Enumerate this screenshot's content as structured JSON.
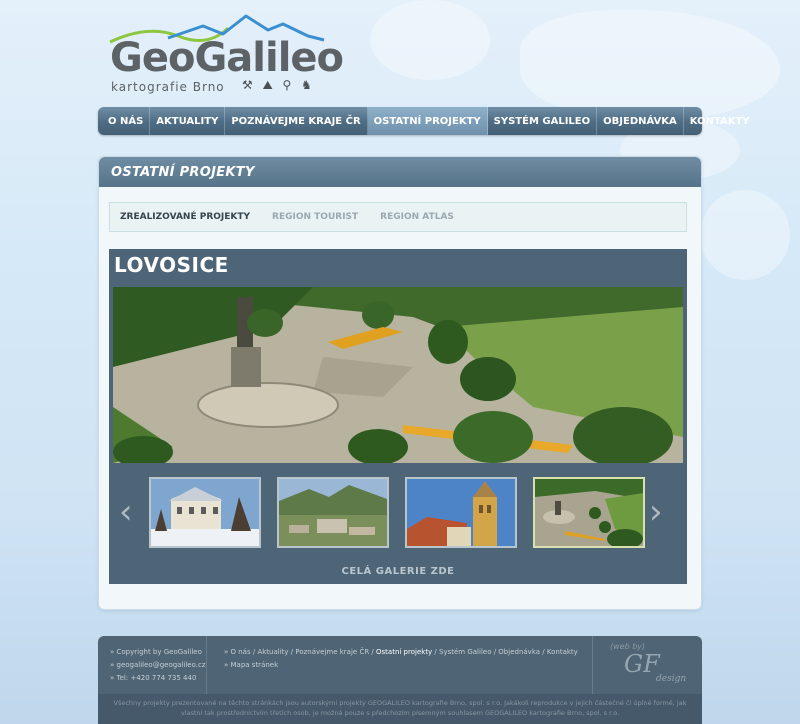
{
  "logo": {
    "title": "GeoGalileo",
    "subtitle": "kartografie Brno",
    "icons": "⚒ ⛰ ⚲ ♞",
    "colors": {
      "green": "#8dc63f",
      "blue": "#3a8fd1",
      "gray": "#5d6266"
    }
  },
  "nav": {
    "items": [
      {
        "label": "O nás"
      },
      {
        "label": "Aktuality"
      },
      {
        "label": "Poznávejme kraje ČR"
      },
      {
        "label": "Ostatní projekty"
      },
      {
        "label": "Systém Galileo"
      },
      {
        "label": "Objednávka"
      },
      {
        "label": "Kontakty"
      }
    ],
    "active_index": 3
  },
  "panel": {
    "title": "Ostatní projekty",
    "subnav": [
      {
        "label": "Zrealizované projekty"
      },
      {
        "label": "Region Tourist"
      },
      {
        "label": "Region Atlas"
      }
    ],
    "gallery": {
      "title": "LOVOSICE",
      "prev_icon": "chevron-left-icon",
      "next_icon": "chevron-right-icon",
      "prev_glyph": "‹",
      "next_glyph": "›",
      "link": "Celá galerie zde"
    }
  },
  "footer": {
    "contacts": [
      "» Copyright by GeoGalileo",
      "» geogalileo@geogalileo.cz",
      "» Tel: +420 774 735 440"
    ],
    "links_prefix": "» ",
    "links": [
      "O nás",
      "Aktuality",
      "Poznávejme kraje ČR",
      "Ostatní projekty",
      "Systém Galileo",
      "Objednávka",
      "Kontakty"
    ],
    "current_link": "Ostatní projekty",
    "sitemap": "» Mapa stránek",
    "webby": "(web by)",
    "gf": "GF",
    "gf_design": "design",
    "notice": "Všechny projekty prezentované na těchto stránkách jsou autorskými projekty GEOGALILEO kartografie Brno, spol. s r.o. Jakákoli reprodukce v jejich částečné či úplné formě, jak vlastní tak prostřednictvím třetích osob, je možná pouze s předchozím písemným souhlasem GEOGALILEO kartografie Brno, spol. s r.o."
  }
}
